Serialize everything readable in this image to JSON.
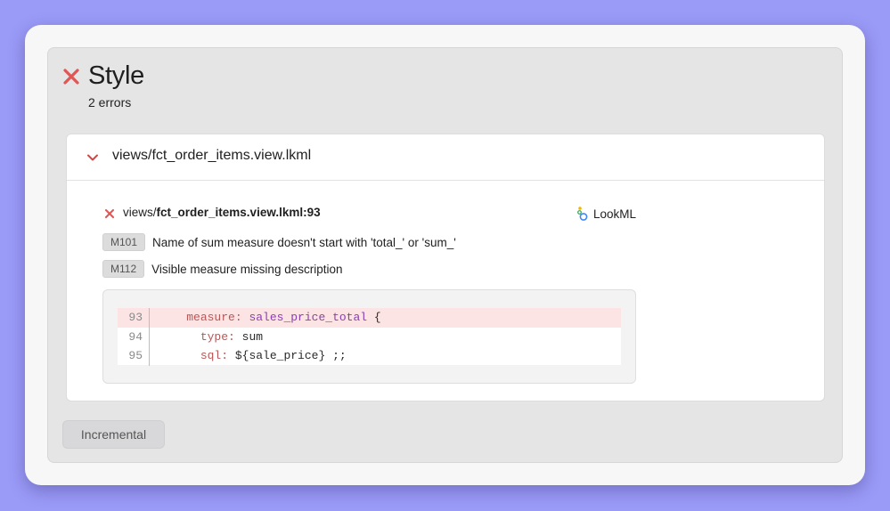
{
  "header": {
    "title": "Style",
    "subtitle": "2 errors",
    "status_icon": "x-icon",
    "status_color": "#e05555"
  },
  "file": {
    "name": "views/fct_order_items.view.lkml",
    "expanded": true,
    "error": {
      "location_prefix": "views/",
      "location_bold": "fct_order_items.view.lkml:93",
      "source_label": "LookML",
      "source_icon": "lookml-icon"
    },
    "rules": [
      {
        "code": "M101",
        "message": "Name of sum measure doesn't start with 'total_' or 'sum_'"
      },
      {
        "code": "M112",
        "message": "Visible measure missing description"
      }
    ],
    "code_lines": [
      {
        "number": "93",
        "key": "measure:",
        "value": "sales_price_total",
        "tail": " {",
        "highlight": true
      },
      {
        "number": "94",
        "key": "type:",
        "value": "sum",
        "tail": "",
        "highlight": false
      },
      {
        "number": "95",
        "key": "sql:",
        "value": "${sale_price}",
        "tail": " ;;",
        "highlight": false
      }
    ]
  },
  "footer": {
    "incremental_label": "Incremental"
  }
}
